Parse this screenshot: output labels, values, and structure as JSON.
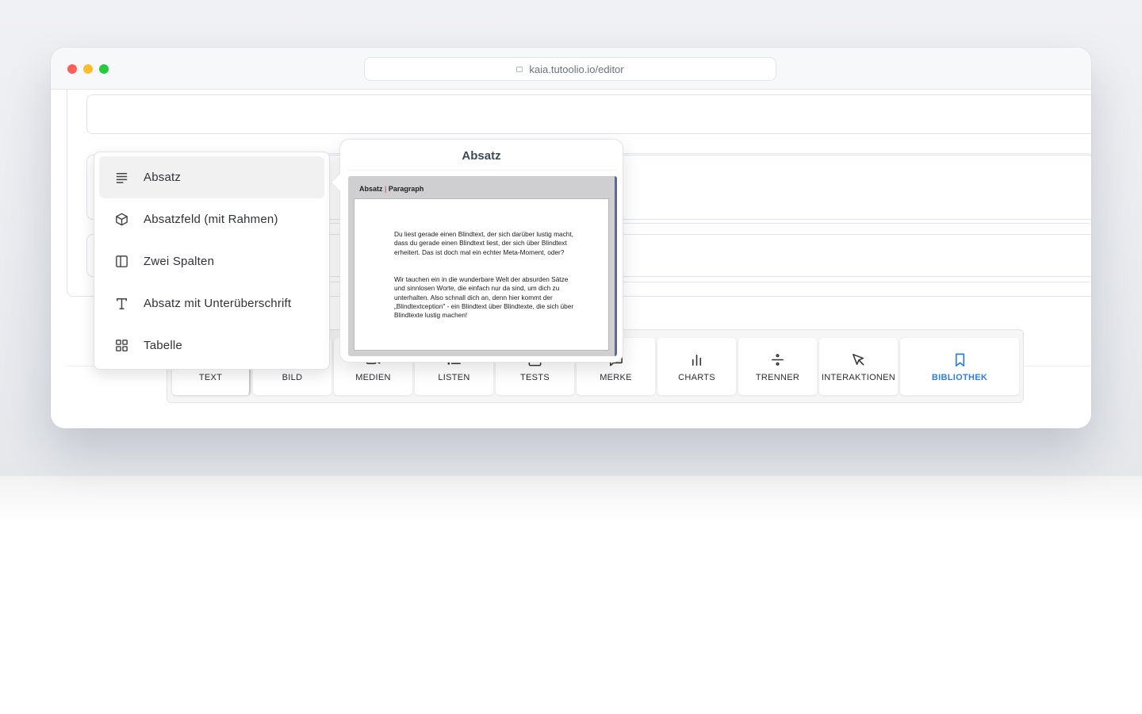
{
  "browser": {
    "url": "kaia.tutoolio.io/editor"
  },
  "menu": {
    "items": [
      {
        "label": "Absatz",
        "icon": "paragraph-lines-icon",
        "active": true
      },
      {
        "label": "Absatzfeld (mit Rahmen)",
        "icon": "cube-icon",
        "active": false
      },
      {
        "label": "Zwei Spalten",
        "icon": "two-columns-icon",
        "active": false
      },
      {
        "label": "Absatz mit Unterüberschrift",
        "icon": "text-t-icon",
        "active": false
      },
      {
        "label": "Tabelle",
        "icon": "grid-icon",
        "active": false
      }
    ]
  },
  "preview": {
    "title": "Absatz",
    "thumb_heading": "Absatz",
    "thumb_heading_separator": "|",
    "thumb_subheading": "Paragraph",
    "paragraph1": "Du liest gerade einen Blindtext, der sich darüber lustig macht, dass du gerade einen Blindtext liest, der sich über Blindtext erheitert. Das ist doch mal ein echter Meta-Moment, oder?",
    "paragraph2": "Wir tauchen ein in die wunderbare Welt der absurden Sätze und sinnlosen Worte, die einfach nur da sind, um dich zu unterhalten. Also schnall dich an, denn hier kommt der „Blindtextception\" - ein Blindtext über Blindtexte, die sich über Blindtexte lustig machen!"
  },
  "toolbar": {
    "items": [
      {
        "label": "TEXT",
        "icon": "text-t-icon"
      },
      {
        "label": "BILD",
        "icon": "image-icon"
      },
      {
        "label": "MEDIEN",
        "icon": "video-camera-icon"
      },
      {
        "label": "LISTEN",
        "icon": "list-icon"
      },
      {
        "label": "TESTS",
        "icon": "checkbox-icon"
      },
      {
        "label": "MERKE",
        "icon": "speech-bubble-icon"
      },
      {
        "label": "CHARTS",
        "icon": "bar-chart-icon"
      },
      {
        "label": "TRENNER",
        "icon": "divide-icon"
      },
      {
        "label": "INTERAKTIONEN",
        "icon": "cursor-arrow-icon"
      },
      {
        "label": "BIBLIOTHEK",
        "icon": "bookmark-icon"
      }
    ]
  },
  "colors": {
    "accent": "#2f7fe0",
    "traffic_red": "#ff5f57",
    "traffic_yellow": "#febc2e",
    "traffic_green": "#28c840"
  }
}
